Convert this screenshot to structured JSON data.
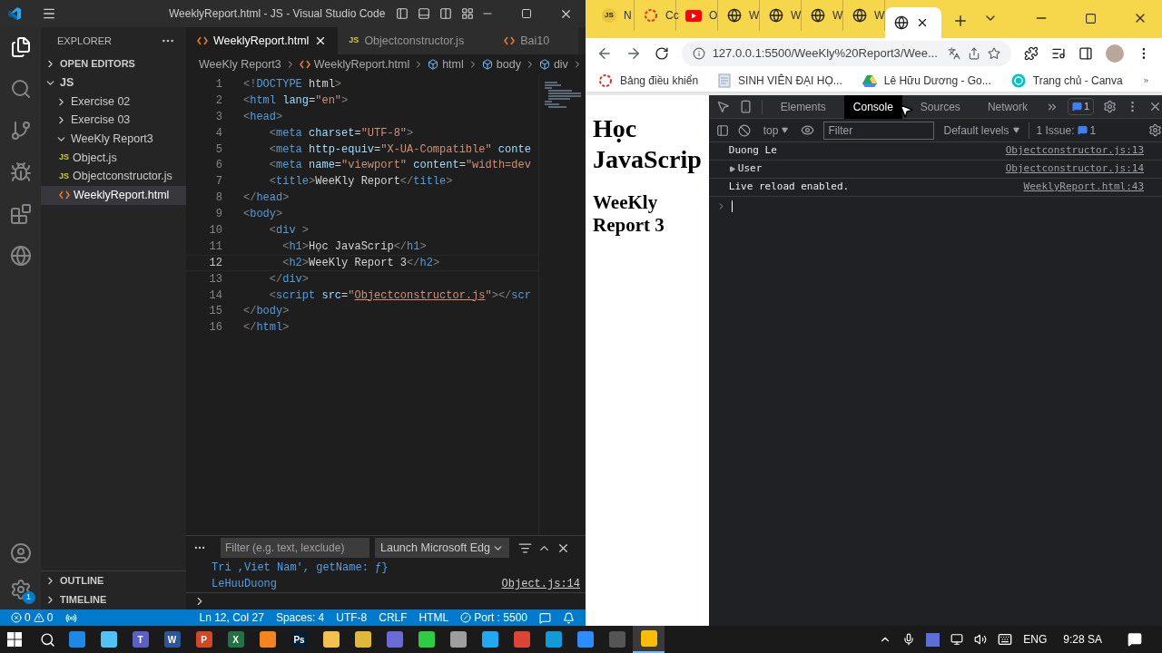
{
  "vscode": {
    "title": "WeeklyReport.html - JS - Visual Studio Code",
    "explorer": {
      "title": "EXPLORER",
      "sections": [
        {
          "label": "OPEN EDITORS",
          "expanded": false
        }
      ],
      "tree": [
        {
          "label": "JS",
          "kind": "root",
          "expanded": true,
          "selected": false,
          "children": [
            {
              "label": "Exercise 02",
              "kind": "folder",
              "expanded": false,
              "selected": false
            },
            {
              "label": "Exercise 03",
              "kind": "folder",
              "expanded": false,
              "selected": false
            },
            {
              "label": "WeeKly Report3",
              "kind": "folder",
              "expanded": true,
              "selected": false,
              "children": [
                {
                  "label": "Object.js",
                  "kind": "js",
                  "icon_label": "JS",
                  "selected": false
                },
                {
                  "label": "Objectconstructor.js",
                  "kind": "js",
                  "icon_label": "JS",
                  "selected": false
                },
                {
                  "label": "WeeklyReport.html",
                  "kind": "html",
                  "selected": true
                }
              ]
            }
          ]
        }
      ],
      "bottom_sections": [
        {
          "label": "OUTLINE",
          "expanded": false
        },
        {
          "label": "TIMELINE",
          "expanded": false
        }
      ]
    },
    "settings_badge": "1",
    "tabs": [
      {
        "label": "WeeklyReport.html",
        "kind": "html",
        "selected": true
      },
      {
        "label": "Objectconstructor.js",
        "kind": "js",
        "icon_label": "JS",
        "selected": false
      },
      {
        "label": "Bai10",
        "kind": "html",
        "selected": false
      }
    ],
    "breadcrumbs": [
      {
        "label": "WeeKly Report3",
        "kind": "folder"
      },
      {
        "label": "WeeklyReport.html",
        "kind": "html"
      },
      {
        "label": "html",
        "kind": "element"
      },
      {
        "label": "body",
        "kind": "element"
      },
      {
        "label": "div",
        "kind": "element"
      }
    ],
    "code": [
      {
        "number": "1",
        "selected": false,
        "tokens": [
          {
            "kind": "punct",
            "text": "<!"
          },
          {
            "kind": "tag",
            "text": "DOCTYPE"
          },
          {
            "kind": "text",
            "text": " html"
          },
          {
            "kind": "punct",
            "text": ">"
          }
        ]
      },
      {
        "number": "2",
        "selected": false,
        "tokens": [
          {
            "kind": "punct",
            "text": "<"
          },
          {
            "kind": "tag",
            "text": "html"
          },
          {
            "kind": "attr",
            "text": " lang"
          },
          {
            "kind": "text",
            "text": "="
          },
          {
            "kind": "string",
            "text": "\"en\""
          },
          {
            "kind": "punct",
            "text": ">"
          }
        ]
      },
      {
        "number": "3",
        "selected": false,
        "tokens": [
          {
            "kind": "punct",
            "text": "<"
          },
          {
            "kind": "tag",
            "text": "head"
          },
          {
            "kind": "punct",
            "text": ">"
          }
        ]
      },
      {
        "number": "4",
        "selected": false,
        "tokens": [
          {
            "kind": "punct",
            "text": "    <"
          },
          {
            "kind": "tag",
            "text": "meta"
          },
          {
            "kind": "attr",
            "text": " charset"
          },
          {
            "kind": "text",
            "text": "="
          },
          {
            "kind": "string",
            "text": "\"UTF-8\""
          },
          {
            "kind": "punct",
            "text": ">"
          }
        ]
      },
      {
        "number": "5",
        "selected": false,
        "tokens": [
          {
            "kind": "punct",
            "text": "    <"
          },
          {
            "kind": "tag",
            "text": "meta"
          },
          {
            "kind": "attr",
            "text": " http-equiv"
          },
          {
            "kind": "text",
            "text": "="
          },
          {
            "kind": "string",
            "text": "\"X-UA-Compatible\""
          },
          {
            "kind": "attr",
            "text": " conte"
          }
        ]
      },
      {
        "number": "6",
        "selected": false,
        "tokens": [
          {
            "kind": "punct",
            "text": "    <"
          },
          {
            "kind": "tag",
            "text": "meta"
          },
          {
            "kind": "attr",
            "text": " name"
          },
          {
            "kind": "text",
            "text": "="
          },
          {
            "kind": "string",
            "text": "\"viewport\""
          },
          {
            "kind": "attr",
            "text": " content"
          },
          {
            "kind": "text",
            "text": "="
          },
          {
            "kind": "string",
            "text": "\"width=dev"
          }
        ]
      },
      {
        "number": "7",
        "selected": false,
        "tokens": [
          {
            "kind": "punct",
            "text": "    <"
          },
          {
            "kind": "tag",
            "text": "title"
          },
          {
            "kind": "punct",
            "text": ">"
          },
          {
            "kind": "text",
            "text": "WeeKly Report"
          },
          {
            "kind": "punct",
            "text": "</"
          },
          {
            "kind": "tag",
            "text": "title"
          },
          {
            "kind": "punct",
            "text": ">"
          }
        ]
      },
      {
        "number": "8",
        "selected": false,
        "tokens": [
          {
            "kind": "punct",
            "text": "</"
          },
          {
            "kind": "tag",
            "text": "head"
          },
          {
            "kind": "punct",
            "text": ">"
          }
        ]
      },
      {
        "number": "9",
        "selected": false,
        "tokens": [
          {
            "kind": "punct",
            "text": "<"
          },
          {
            "kind": "tag",
            "text": "body"
          },
          {
            "kind": "punct",
            "text": ">"
          }
        ]
      },
      {
        "number": "10",
        "selected": false,
        "tokens": [
          {
            "kind": "punct",
            "text": "    <"
          },
          {
            "kind": "tag",
            "text": "div"
          },
          {
            "kind": "punct",
            "text": " >"
          }
        ]
      },
      {
        "number": "11",
        "selected": false,
        "tokens": [
          {
            "kind": "punct",
            "text": "      <"
          },
          {
            "kind": "tag",
            "text": "h1"
          },
          {
            "kind": "punct",
            "text": ">"
          },
          {
            "kind": "text",
            "text": "Học JavaScrip"
          },
          {
            "kind": "punct",
            "text": "</"
          },
          {
            "kind": "tag",
            "text": "h1"
          },
          {
            "kind": "punct",
            "text": ">"
          }
        ]
      },
      {
        "number": "12",
        "selected": true,
        "tokens": [
          {
            "kind": "punct",
            "text": "      <"
          },
          {
            "kind": "tag",
            "text": "h2"
          },
          {
            "kind": "punct",
            "text": ">"
          },
          {
            "kind": "text",
            "text": "WeeKly Report 3"
          },
          {
            "kind": "punct",
            "text": "</"
          },
          {
            "kind": "tag",
            "text": "h2"
          },
          {
            "kind": "punct",
            "text": ">"
          }
        ]
      },
      {
        "number": "13",
        "selected": false,
        "tokens": [
          {
            "kind": "punct",
            "text": "    </"
          },
          {
            "kind": "tag",
            "text": "div"
          },
          {
            "kind": "punct",
            "text": ">"
          }
        ]
      },
      {
        "number": "14",
        "selected": false,
        "tokens": [
          {
            "kind": "punct",
            "text": "    <"
          },
          {
            "kind": "tag",
            "text": "script"
          },
          {
            "kind": "attr",
            "text": " src"
          },
          {
            "kind": "text",
            "text": "="
          },
          {
            "kind": "string",
            "text": "\""
          },
          {
            "kind": "link",
            "text": "Objectconstructor.js"
          },
          {
            "kind": "string",
            "text": "\""
          },
          {
            "kind": "punct",
            "text": "></"
          },
          {
            "kind": "tag",
            "text": "scr"
          }
        ]
      },
      {
        "number": "15",
        "selected": false,
        "tokens": [
          {
            "kind": "punct",
            "text": "</"
          },
          {
            "kind": "tag",
            "text": "body"
          },
          {
            "kind": "punct",
            "text": ">"
          }
        ]
      },
      {
        "number": "16",
        "selected": false,
        "tokens": [
          {
            "kind": "punct",
            "text": "</"
          },
          {
            "kind": "tag",
            "text": "html"
          },
          {
            "kind": "punct",
            "text": ">"
          }
        ]
      }
    ],
    "panel": {
      "filter_placeholder": "Filter (e.g. text, lexclude)",
      "launch_config": "Launch Microsoft Edg",
      "lines": [
        {
          "text": "Tri ,Viet Nam', getName: ƒ}"
        },
        {
          "text": "LeHuuDuong",
          "source": "Object.js:14"
        }
      ]
    },
    "status_bar": {
      "errors": "0",
      "warnings": "0",
      "items": [
        "Ln 12, Col 27",
        "Spaces: 4",
        "UTF-8",
        "CRLF",
        "HTML"
      ],
      "port": "Port : 5500"
    }
  },
  "browser": {
    "tabs": [
      {
        "kind": "js",
        "icon_label": "JS",
        "label": "N",
        "selected": false
      },
      {
        "kind": "ring",
        "label": "Cc",
        "selected": false
      },
      {
        "kind": "youtube",
        "label": "O",
        "selected": false
      },
      {
        "kind": "globe",
        "label": "W",
        "selected": false
      },
      {
        "kind": "globe",
        "label": "W",
        "selected": false
      },
      {
        "kind": "globe",
        "label": "W",
        "selected": false
      },
      {
        "kind": "globe",
        "label": "W",
        "selected": false
      },
      {
        "kind": "globe",
        "selected": true
      }
    ],
    "address": "127.0.0.1:5500/WeeKly%20Report3/Wee...",
    "bookmarks": [
      {
        "label": "Bảng điều khiển",
        "kind": "ring"
      },
      {
        "label": "SINH VIÊN ĐẠI HỌ...",
        "kind": "doc"
      },
      {
        "label": "Lê Hữu Dương - Go...",
        "kind": "drive"
      },
      {
        "label": "Trang chủ - Canva",
        "kind": "canva"
      }
    ],
    "page": {
      "h1": "Học JavaScrip",
      "h2": "WeeKly Report 3"
    },
    "devtools": {
      "tabs": [
        {
          "label": "Elements",
          "selected": false
        },
        {
          "label": "Console",
          "selected": true
        },
        {
          "label": "Sources",
          "selected": false
        },
        {
          "label": "Network",
          "selected": false
        }
      ],
      "message_badge": "1",
      "context": "top",
      "filter_placeholder": "Filter",
      "levels": "Default levels",
      "issues_label": "1 Issue:",
      "issues_count": "1",
      "messages": [
        {
          "text": "Duong Le",
          "source": "Objectconstructor.js:13",
          "expandable": false
        },
        {
          "text": "User",
          "source": "Objectconstructor.js:14",
          "expandable": true
        },
        {
          "text": "Live reload enabled.",
          "source": "WeeklyReport.html:43",
          "expandable": false
        }
      ]
    }
  },
  "taskbar": {
    "apps": [
      {
        "color": "#1e88e5",
        "selected": false
      },
      {
        "color": "#4fc3f7",
        "selected": false
      },
      {
        "color": "#5b5fc7",
        "label": "T",
        "selected": false
      },
      {
        "color": "#2b579a",
        "label": "W",
        "selected": false
      },
      {
        "color": "#d24726",
        "label": "P",
        "selected": false
      },
      {
        "color": "#217346",
        "label": "X",
        "selected": false
      },
      {
        "color": "#f4841f",
        "selected": false
      },
      {
        "color": "#001e36",
        "label": "Ps",
        "selected": false
      },
      {
        "color": "#f2c14e",
        "selected": false
      },
      {
        "color": "#e0b83a",
        "selected": false
      },
      {
        "color": "#6a6ad8",
        "selected": false
      },
      {
        "color": "#2ecc40",
        "selected": false
      },
      {
        "color": "#9e9e9e",
        "selected": false
      },
      {
        "color": "#23a9f2",
        "selected": false
      },
      {
        "color": "#db4437",
        "selected": false
      },
      {
        "color": "#0f9bd7",
        "selected": false
      },
      {
        "color": "#2d8cff",
        "selected": false
      },
      {
        "color": "#555555",
        "selected": false
      },
      {
        "color": "#fbbc05",
        "selected": true
      }
    ],
    "language": "ENG",
    "time": "9:28 SA"
  }
}
